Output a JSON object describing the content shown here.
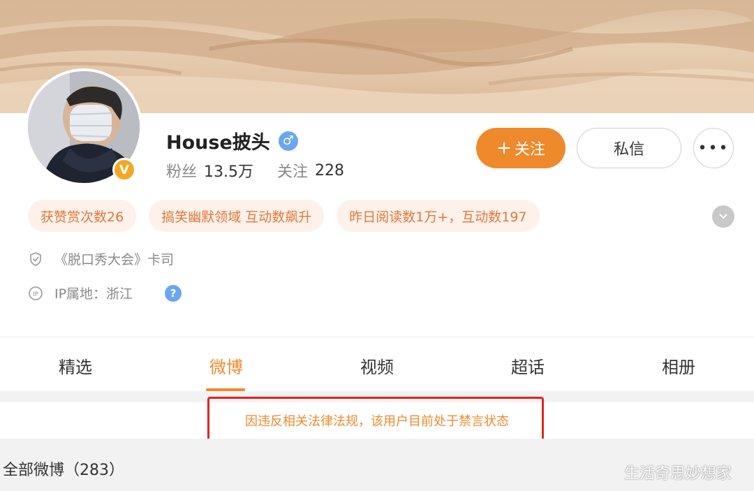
{
  "profile": {
    "username": "House披头",
    "gender_icon": "♂",
    "verified_badge": "V",
    "stats": [
      {
        "label": "粉丝",
        "value": "13.5万"
      },
      {
        "label": "关注",
        "value": "228"
      }
    ]
  },
  "actions": {
    "follow_plus": "+",
    "follow_label": "关注",
    "message_label": "私信",
    "more_label": "•••"
  },
  "tags": [
    "获赞赏次数26",
    "搞笑幽默领域 互动数飙升",
    "昨日阅读数1万+，互动数197"
  ],
  "info": {
    "certification": "《脱口秀大会》卡司",
    "ip_location": "IP属地：浙江",
    "help": "?"
  },
  "tabs": [
    "精选",
    "微博",
    "视频",
    "超话",
    "相册"
  ],
  "active_tab": "微博",
  "notice": "因违反相关法律法规，该用户目前处于禁言状态",
  "all_weibo": "全部微博（283）",
  "watermark": "生活奇思妙想家",
  "colors": {
    "accent": "#ee8a2c",
    "tag_bg": "#fdf1ea",
    "tag_text": "#e2773a",
    "highlight": "#e3231e",
    "blue": "#6aa7f0"
  }
}
